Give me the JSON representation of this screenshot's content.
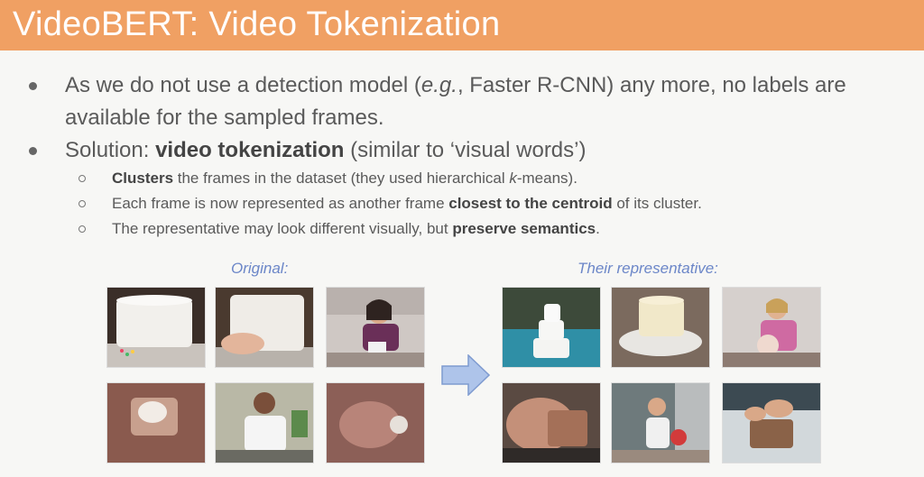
{
  "title": "VideoBERT: Video Tokenization",
  "bullet1": {
    "part_a": "As we do not use a detection model (",
    "eg": "e.g.",
    "part_b": ", Faster R-CNN) any more, no labels are",
    "line2": "available for the sampled frames."
  },
  "bullet2": {
    "prefix": "Solution: ",
    "bold": "video tokenization",
    "suffix": " (similar to ‘visual words’)"
  },
  "sub1": {
    "bold": "Clusters",
    "text_a": " the frames in the dataset (they used hierarchical ",
    "k": "k",
    "text_b": "-means)."
  },
  "sub2": {
    "text": "Each frame is now represented as another frame ",
    "bold": "closest to the centroid",
    "suffix": " of its cluster."
  },
  "sub3": {
    "text": "The representative may look different visually, but ",
    "bold": "preserve semantics",
    "suffix": "."
  },
  "captions": {
    "original": "Original:",
    "representative": "Their representative:"
  },
  "colors": {
    "title_bar": "#f0a063",
    "caption": "#6b86c8",
    "arrow_fill": "#aec4ea",
    "arrow_stroke": "#7f9bd0"
  }
}
